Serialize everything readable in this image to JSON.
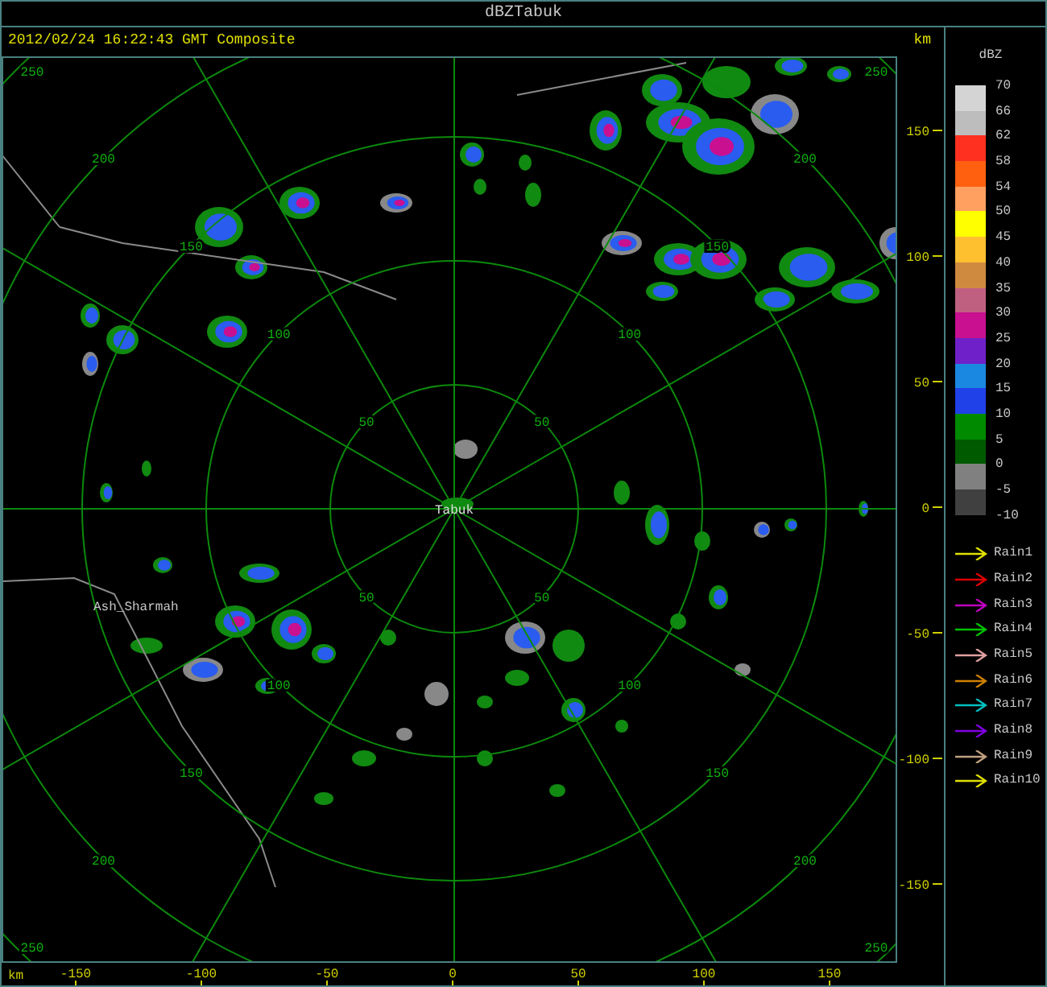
{
  "window": {
    "title": "dBZTabuk"
  },
  "header": {
    "timestamp": "2012/02/24 16:22:43 GMT Composite",
    "unit": "km"
  },
  "plot": {
    "site_label": "Tabuk",
    "place_labels": [
      "Ash_Sharmah"
    ],
    "rings": [
      {
        "labels": [
          "50",
          "50",
          "50",
          "50"
        ]
      },
      {
        "labels": [
          "100",
          "100",
          "100",
          "100"
        ]
      },
      {
        "labels": [
          "150",
          "150",
          "150",
          "150"
        ]
      },
      {
        "labels": [
          "200",
          "200",
          "200",
          "200"
        ]
      },
      {
        "labels": [
          "250",
          "250",
          "250",
          "250"
        ]
      }
    ]
  },
  "y_axis": {
    "ticks": [
      "150",
      "100",
      "50",
      "0",
      "-50",
      "-100",
      "-150"
    ]
  },
  "x_axis": {
    "unit": "km",
    "ticks": [
      "-150",
      "-100",
      "-50",
      "0",
      "50",
      "100",
      "150"
    ]
  },
  "legend": {
    "title": "dBZ",
    "bands": [
      {
        "color": "#d4d4d4"
      },
      {
        "color": "#bdbdbd"
      },
      {
        "color": "#ff3020"
      },
      {
        "color": "#ff6010"
      },
      {
        "color": "#ff9f60"
      },
      {
        "color": "#ffff00"
      },
      {
        "color": "#ffc030"
      },
      {
        "color": "#d08a40"
      },
      {
        "color": "#c06080"
      },
      {
        "color": "#c81090"
      },
      {
        "color": "#7020c8"
      },
      {
        "color": "#1a88e0"
      },
      {
        "color": "#2040e8"
      },
      {
        "color": "#008a00"
      },
      {
        "color": "#005a00"
      },
      {
        "color": "#808080"
      },
      {
        "color": "#404040"
      }
    ],
    "labels": [
      "70",
      "66",
      "62",
      "58",
      "54",
      "50",
      "45",
      "40",
      "35",
      "30",
      "25",
      "20",
      "15",
      "10",
      "5",
      "0",
      "-5",
      "-10"
    ],
    "tracks": [
      {
        "label": "Rain1",
        "color": "#e0e000"
      },
      {
        "label": "Rain2",
        "color": "#e00000"
      },
      {
        "label": "Rain3",
        "color": "#c000c0"
      },
      {
        "label": "Rain4",
        "color": "#00c000"
      },
      {
        "label": "Rain5",
        "color": "#e0a0a0"
      },
      {
        "label": "Rain6",
        "color": "#d08000"
      },
      {
        "label": "Rain7",
        "color": "#00c0c0"
      },
      {
        "label": "Rain8",
        "color": "#8000e0"
      },
      {
        "label": "Rain9",
        "color": "#c0a080"
      },
      {
        "label": "Rain10",
        "color": "#e0e000"
      }
    ]
  }
}
